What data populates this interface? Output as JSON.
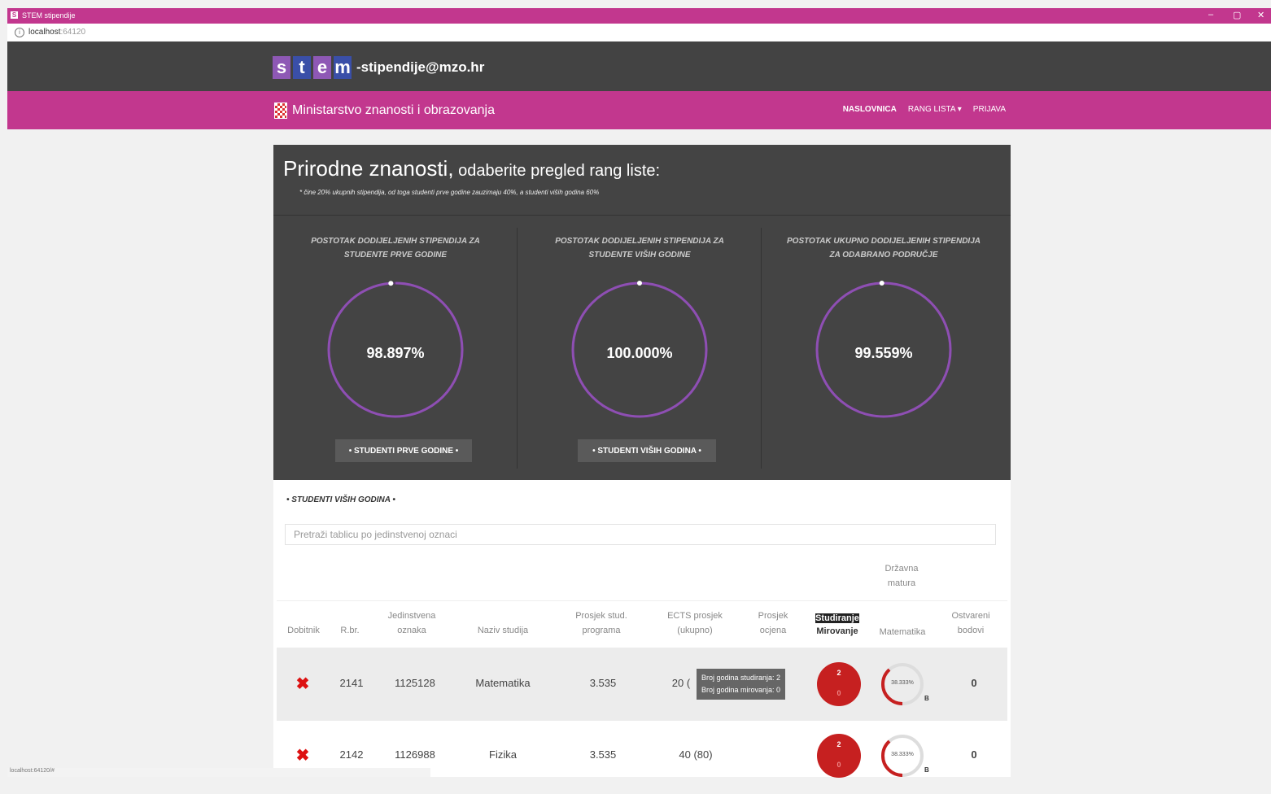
{
  "window": {
    "title": "STEM stipendije",
    "app_icon": "S"
  },
  "address": {
    "host": "localhost",
    "port": ":64120"
  },
  "header": {
    "logo_letters": [
      "s",
      "t",
      "e",
      "m"
    ],
    "logo_colors": [
      "#8e58b5",
      "#3a4fa8",
      "#8e58b5",
      "#3a4fa8"
    ],
    "email": "-stipendije@mzo.hr",
    "ministry": "Ministarstvo znanosti i obrazovanja",
    "nav": [
      "NASLOVNICA",
      "RANG LISTA ▾",
      "PRIJAVA"
    ]
  },
  "panel": {
    "title_big": "Prirodne znanosti,",
    "title_small": " odaberite pregled rang liste:",
    "note": "* čine 20% ukupnih stipendija, od toga studenti prve godine zauzimaju 40%, a studenti viših godina 60%",
    "stats": [
      {
        "caption": "Postotak dodijeljenih stipendija za studente prve godine",
        "value": "98.897%",
        "fraction": 0.98897,
        "button": "• STUDENTI PRVE GODINE •"
      },
      {
        "caption": "Postotak dodijeljenih stipendija za studente viših godine",
        "value": "100.000%",
        "fraction": 1.0,
        "button": "• STUDENTI VIŠIH GODINA •"
      },
      {
        "caption": "Postotak ukupno dodijeljenih stipendija za odabrano područje",
        "value": "99.559%",
        "fraction": 0.99559,
        "button": ""
      }
    ],
    "ring_color": "#8e4fb3"
  },
  "table": {
    "subtitle": "• STUDENTI VIŠIH GODINA •",
    "search_placeholder": "Pretraži tablicu po jedinstvenoj oznaci",
    "group_header": "Državna matura",
    "headers": {
      "dobitnik": "Dobitnik",
      "rbr": "R.br.",
      "oznaka": "Jedinstvena oznaka",
      "naziv": "Naziv studija",
      "prosjek_programa": "Prosjek stud. programa",
      "ects": "ECTS prosjek (ukupno)",
      "prosjek_ocjena": "Prosjek ocjena",
      "studiranje": "Studiranje",
      "mirovanje": "Mirovanje",
      "matematika": "Matematika",
      "bodovi": "Ostvareni bodovi"
    },
    "rows": [
      {
        "dobitnik": "✖",
        "rbr": "2141",
        "oznaka": "1125128",
        "naziv": "Matematika",
        "prosjek": "3.535",
        "ects": "20 (",
        "stud": "2",
        "mir": "0",
        "mat_pct": "38.333%",
        "mat_fraction": 0.38333,
        "mat_sub": "B",
        "bodovi": "0"
      },
      {
        "dobitnik": "✖",
        "rbr": "2142",
        "oznaka": "1126988",
        "naziv": "Fizika",
        "prosjek": "3.535",
        "ects": "40 (80)",
        "stud": "2",
        "mir": "0",
        "mat_pct": "38.333%",
        "mat_fraction": 0.38333,
        "mat_sub": "B",
        "bodovi": "0"
      }
    ],
    "tooltip": {
      "line1": "Broj godina studiranja: 2",
      "line2": "Broj godina mirovanja: 0"
    }
  },
  "status_bar": "localhost:64120/#"
}
